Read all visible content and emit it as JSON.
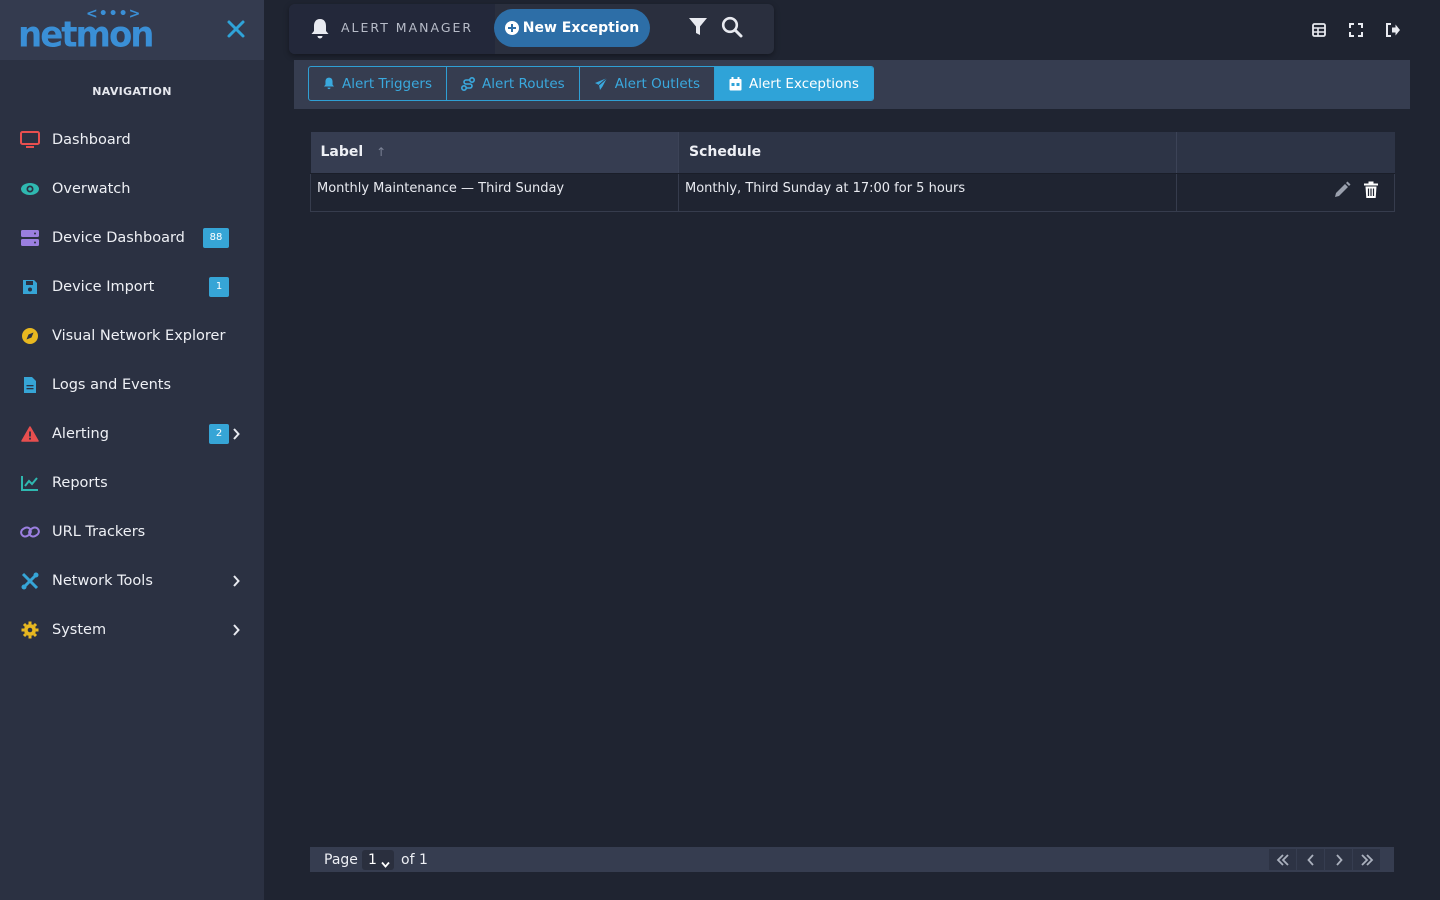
{
  "app": {
    "logo_text": "netmon",
    "logo_dots": "<•••>"
  },
  "sidebar": {
    "title": "NAVIGATION",
    "items": [
      {
        "label": "Dashboard",
        "icon": "monitor-icon",
        "color": "#e84f4f"
      },
      {
        "label": "Overwatch",
        "icon": "eye-icon",
        "color": "#2fb8b0"
      },
      {
        "label": "Device Dashboard",
        "icon": "server-icon",
        "color": "#9b7fe0",
        "badge": "88"
      },
      {
        "label": "Device Import",
        "icon": "save-icon",
        "color": "#36a5d6",
        "badge": "1"
      },
      {
        "label": "Visual Network Explorer",
        "icon": "compass-icon",
        "color": "#e8b820"
      },
      {
        "label": "Logs and Events",
        "icon": "file-icon",
        "color": "#36a5d6"
      },
      {
        "label": "Alerting",
        "icon": "warning-icon",
        "color": "#e84f4f",
        "badge": "2"
      },
      {
        "label": "Reports",
        "icon": "chart-line-icon",
        "color": "#2fb8b0"
      },
      {
        "label": "URL Trackers",
        "icon": "link-icon",
        "color": "#9b7fe0"
      },
      {
        "label": "Network Tools",
        "icon": "tools-icon",
        "color": "#36a5d6"
      },
      {
        "label": "System",
        "icon": "gear-icon",
        "color": "#e8b820"
      }
    ]
  },
  "toolbar": {
    "title": "ALERT MANAGER",
    "new_button": "New Exception"
  },
  "tabs": [
    {
      "label": "Alert Triggers",
      "active": false
    },
    {
      "label": "Alert Routes",
      "active": false
    },
    {
      "label": "Alert Outlets",
      "active": false
    },
    {
      "label": "Alert Exceptions",
      "active": true
    }
  ],
  "table": {
    "columns": [
      "Label",
      "Schedule",
      ""
    ],
    "sort_indicator": "↑",
    "rows": [
      {
        "label": "Monthly Maintenance — Third Sunday",
        "schedule": "Monthly, Third Sunday at 17:00 for 5 hours"
      }
    ]
  },
  "pager": {
    "page_label": "Page",
    "current": "1",
    "of_label": "of 1"
  },
  "colors": {
    "accent": "#2fa3d8",
    "sidebar_bg": "#2b3142",
    "main_bg": "#1f2431"
  }
}
